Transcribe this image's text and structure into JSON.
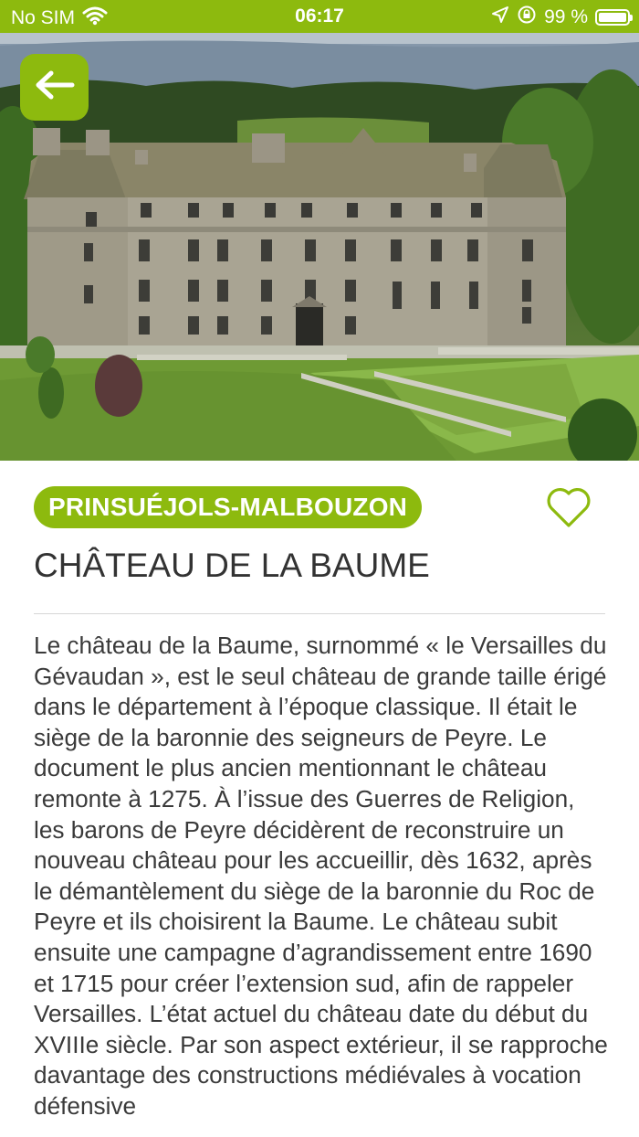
{
  "status_bar": {
    "carrier": "No SIM",
    "time": "06:17",
    "battery": "99 %",
    "battery_level": 0.99
  },
  "hero": {
    "image": "chateau-photo",
    "carousel_count": 1,
    "carousel_active": 1
  },
  "place": {
    "location": "PRINSUÉJOLS-MALBOUZON",
    "title": "CHÂTEAU DE LA BAUME",
    "description": "Le château de la Baume, surnommé « le Versailles du Gévaudan », est le seul château de grande taille érigé dans le département à l’époque classique. Il était le siège de la baronnie des seigneurs de Peyre. Le document le plus ancien mentionnant le château remonte à 1275. À l’issue des Guerres de Religion, les barons de Peyre décidèrent de reconstruire un nouveau château pour les accueillir, dès 1632, après le démantèlement du siège de la baronnie du Roc de Peyre et ils choisirent la Baume. Le château subit ensuite une campagne d’agrandissement entre 1690 et 1715 pour créer l’extension sud, afin de rappeler Versailles.  L’état actuel du château date du début du XVIIIe siècle. Par son aspect extérieur, il se rapproche davantage des constructions médiévales à vocation défensive"
  },
  "colors": {
    "accent": "#8dba0e",
    "text": "#333333"
  }
}
